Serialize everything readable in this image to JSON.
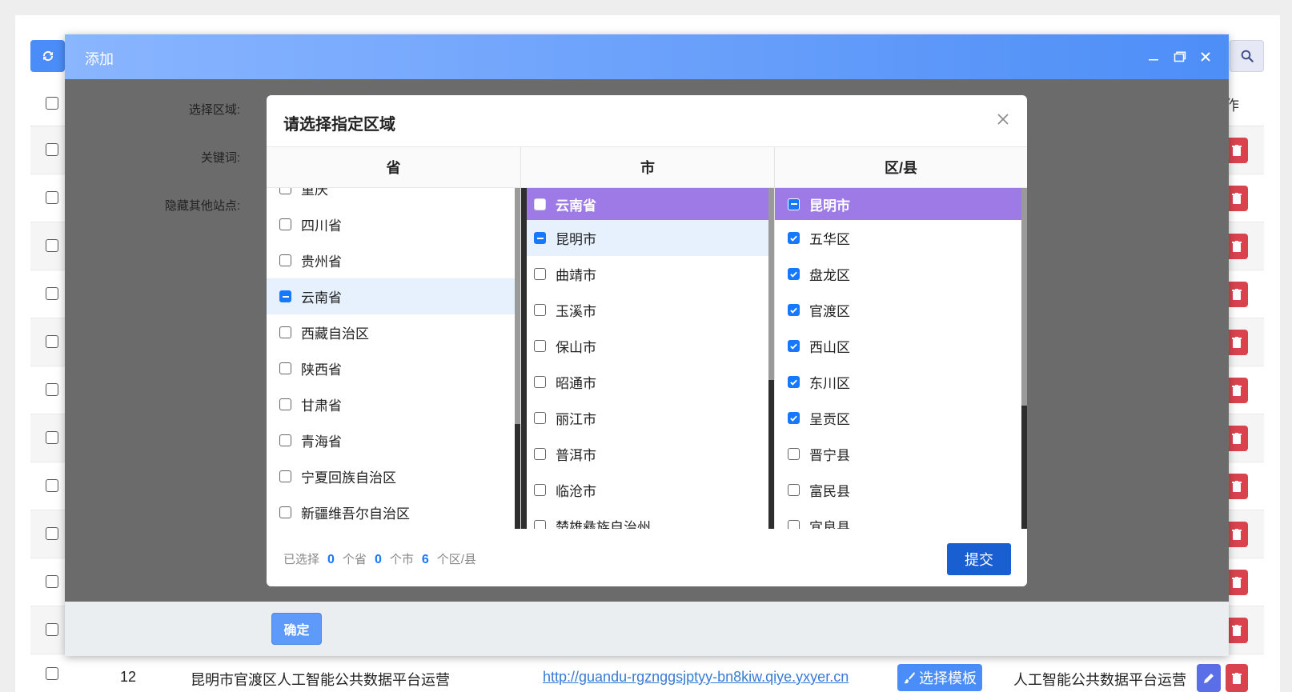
{
  "background": {
    "header_op": "作",
    "last_row": {
      "num": "12",
      "name": "昆明市官渡区人工智能公共数据平台运营",
      "url": "http://guandu-rgznggsjptyy-bn8kiw.qiye.yxyer.cn",
      "template_button": "选择模板",
      "desc": "人工智能公共数据平台运营"
    }
  },
  "outer_modal": {
    "title": "添加",
    "labels": {
      "region": "选择区域:",
      "keyword": "关键词:",
      "hide_sites": "隐藏其他站点:"
    },
    "confirm": "确定"
  },
  "dialog": {
    "title": "请选择指定区域",
    "columns": {
      "province": "省",
      "city": "市",
      "district": "区/县"
    },
    "provinces": [
      {
        "label": "重庆",
        "state": "unchecked"
      },
      {
        "label": "四川省",
        "state": "unchecked"
      },
      {
        "label": "贵州省",
        "state": "unchecked"
      },
      {
        "label": "云南省",
        "state": "partial"
      },
      {
        "label": "西藏自治区",
        "state": "unchecked"
      },
      {
        "label": "陕西省",
        "state": "unchecked"
      },
      {
        "label": "甘肃省",
        "state": "unchecked"
      },
      {
        "label": "青海省",
        "state": "unchecked"
      },
      {
        "label": "宁夏回族自治区",
        "state": "unchecked"
      },
      {
        "label": "新疆维吾尔自治区",
        "state": "unchecked"
      }
    ],
    "city_group": "云南省",
    "cities": [
      {
        "label": "昆明市",
        "state": "partial"
      },
      {
        "label": "曲靖市",
        "state": "unchecked"
      },
      {
        "label": "玉溪市",
        "state": "unchecked"
      },
      {
        "label": "保山市",
        "state": "unchecked"
      },
      {
        "label": "昭通市",
        "state": "unchecked"
      },
      {
        "label": "丽江市",
        "state": "unchecked"
      },
      {
        "label": "普洱市",
        "state": "unchecked"
      },
      {
        "label": "临沧市",
        "state": "unchecked"
      },
      {
        "label": "楚雄彝族自治州",
        "state": "unchecked"
      }
    ],
    "district_group": "昆明市",
    "districts": [
      {
        "label": "五华区",
        "state": "checked"
      },
      {
        "label": "盘龙区",
        "state": "checked"
      },
      {
        "label": "官渡区",
        "state": "checked"
      },
      {
        "label": "西山区",
        "state": "checked"
      },
      {
        "label": "东川区",
        "state": "checked"
      },
      {
        "label": "呈贡区",
        "state": "checked"
      },
      {
        "label": "晋宁县",
        "state": "unchecked"
      },
      {
        "label": "富民县",
        "state": "unchecked"
      },
      {
        "label": "宜良县",
        "state": "unchecked"
      }
    ],
    "summary": {
      "prefix": "已选择",
      "province_count": "0",
      "province_unit": "个省",
      "city_count": "0",
      "city_unit": "个市",
      "district_count": "6",
      "district_unit": "个区/县"
    },
    "submit": "提交"
  },
  "colors": {
    "accent": "#1677ff",
    "group_header": "#9e7ae6",
    "submit": "#1a5fd1",
    "delete": "#d9434e"
  }
}
